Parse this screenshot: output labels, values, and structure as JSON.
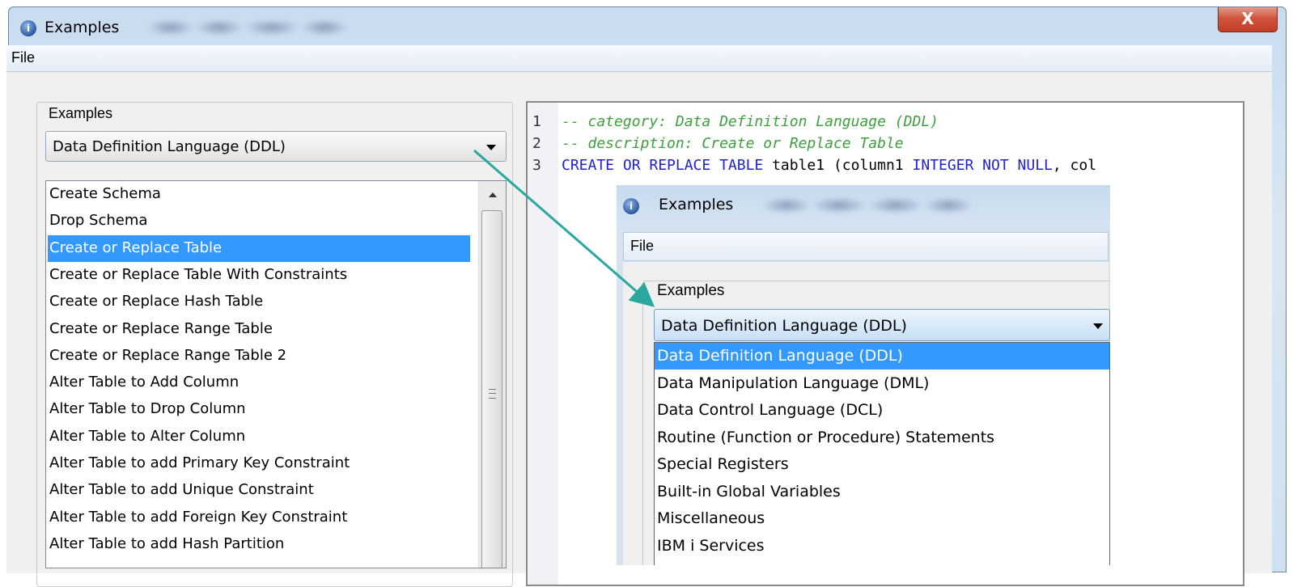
{
  "window": {
    "title": "Examples",
    "close_label": "X"
  },
  "menubar": {
    "file_label": "File"
  },
  "examples_panel": {
    "group_label": "Examples",
    "category_selected": "Data Definition Language (DDL)",
    "items": [
      "Create Schema",
      "Drop Schema",
      "Create or Replace Table",
      "Create or Replace Table With Constraints",
      "Create or Replace Hash Table",
      "Create or Replace Range Table",
      "Create or Replace Range Table 2",
      "Alter Table to Add Column",
      "Alter Table to Drop Column",
      "Alter Table to Alter Column",
      "Alter Table to add Primary Key Constraint",
      "Alter Table to add Unique Constraint",
      "Alter Table to add Foreign Key Constraint",
      "Alter Table to add Hash Partition"
    ],
    "selected_index": 2
  },
  "editor": {
    "lines": [
      {
        "num": "1",
        "comment": "--  category:  Data Definition Language (DDL)"
      },
      {
        "num": "2",
        "comment": "--  description:  Create or Replace Table"
      },
      {
        "num": "3",
        "kw1": "CREATE OR REPLACE TABLE",
        "plain1": " table1 (column1 ",
        "kw2": "INTEGER NOT NULL",
        "plain2": ", col"
      }
    ]
  },
  "inset": {
    "title": "Examples",
    "file_label": "File",
    "group_label": "Examples",
    "category_selected": "Data Definition Language (DDL)",
    "options": [
      "Data Definition Language (DDL)",
      "Data Manipulation Language (DML)",
      "Data Control Language (DCL)",
      "Routine (Function or Procedure) Statements",
      "Special Registers",
      "Built-in Global Variables",
      "Miscellaneous",
      "IBM i Services"
    ],
    "highlighted_index": 0
  },
  "colors": {
    "selection": "#3399ff",
    "comment": "#3f9f3f",
    "keyword": "#2222cc",
    "callout_arrow": "#2aa8a0"
  }
}
